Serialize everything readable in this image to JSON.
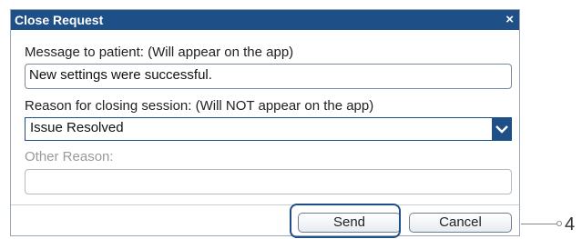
{
  "dialog": {
    "title": "Close Request",
    "close_glyph": "×",
    "message_label": "Message to patient: (Will appear on the app)",
    "message_value": "New settings were successful.",
    "reason_label": "Reason for closing session: (Will NOT appear on the app)",
    "reason_selected": "Issue Resolved",
    "other_reason_label": "Other Reason:",
    "other_reason_value": "",
    "send_label": "Send",
    "cancel_label": "Cancel"
  },
  "callout": {
    "number": "4"
  },
  "icons": {
    "close": "close-icon",
    "dropdown": "chevron-down-icon"
  },
  "colors": {
    "titlebar": "#1e4f86",
    "highlight": "#1e4f86"
  }
}
